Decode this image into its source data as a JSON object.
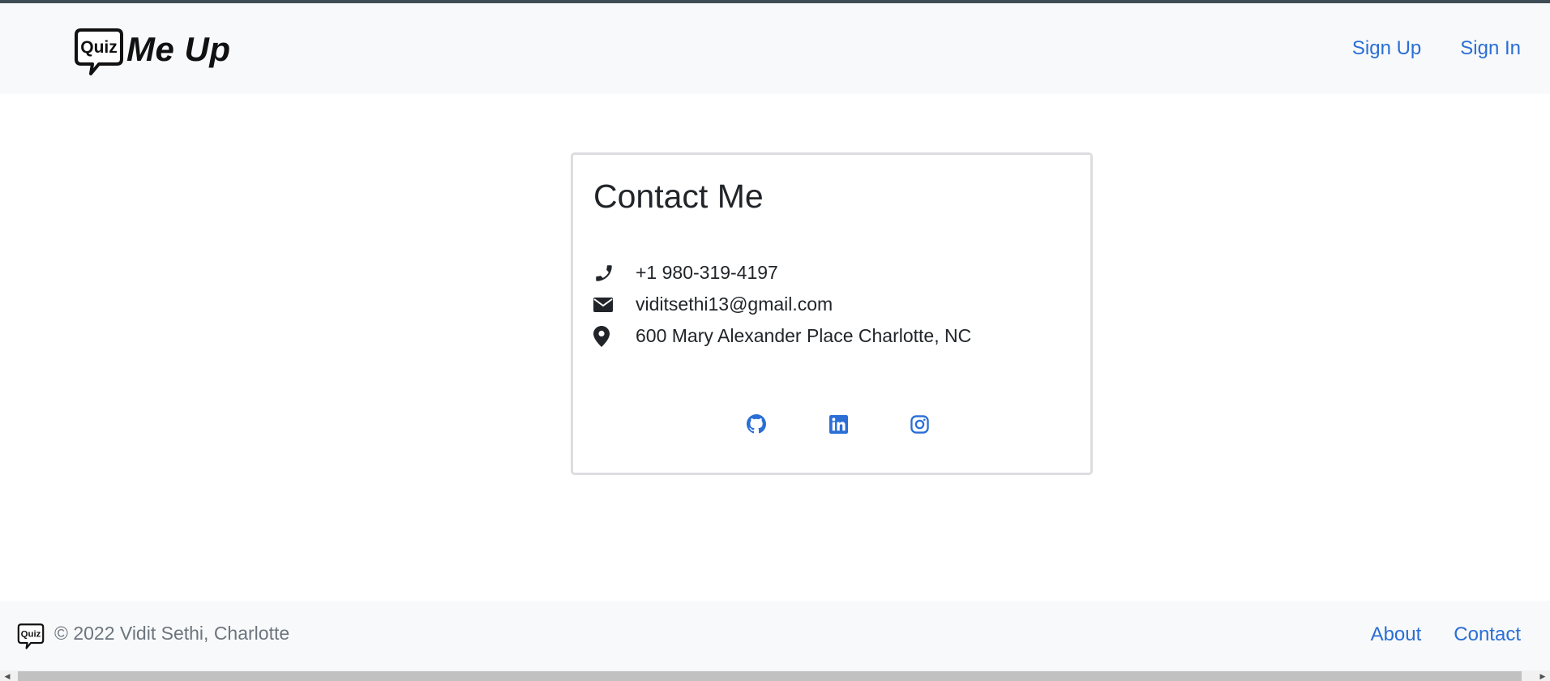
{
  "header": {
    "brand_logo_text": "Quiz",
    "brand_text": "Me Up",
    "links": [
      {
        "label": "Sign Up"
      },
      {
        "label": "Sign In"
      }
    ]
  },
  "contact_card": {
    "title": "Contact Me",
    "items": [
      {
        "icon": "phone-icon",
        "text": "+1 980-319-4197"
      },
      {
        "icon": "envelope-icon",
        "text": "viditsethi13@gmail.com"
      },
      {
        "icon": "map-pin-icon",
        "text": "600 Mary Alexander Place Charlotte, NC"
      }
    ],
    "social": [
      {
        "icon": "github-icon"
      },
      {
        "icon": "linkedin-icon"
      },
      {
        "icon": "instagram-icon"
      }
    ]
  },
  "footer": {
    "logo_text": "Quiz",
    "copyright": "© 2022 Vidit Sethi, Charlotte",
    "links": [
      {
        "label": "About"
      },
      {
        "label": "Contact"
      }
    ]
  },
  "colors": {
    "link": "#2a6ed6",
    "navbar_bg": "#f8f9fa",
    "card_border": "#dcdde0",
    "footer_text": "#6c757d"
  }
}
